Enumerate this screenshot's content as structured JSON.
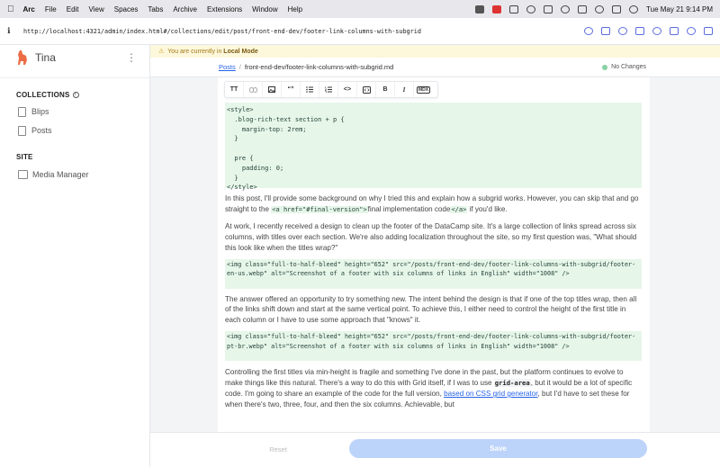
{
  "menubar": {
    "app": "Arc",
    "items": [
      "File",
      "Edit",
      "View",
      "Spaces",
      "Tabs",
      "Archive",
      "Extensions",
      "Window",
      "Help"
    ],
    "datetime": "Tue May 21  9:14 PM"
  },
  "browser": {
    "url": "http://localhost:4321/admin/index.html#/collections/edit/post/front-end-dev/footer-link-columns-with-subgrid"
  },
  "sidebar": {
    "brand": "Tina",
    "collections_title": "COLLECTIONS",
    "collections": [
      "Blips",
      "Posts"
    ],
    "site_title": "SITE",
    "site_items": [
      "Media Manager"
    ]
  },
  "banner": {
    "prefix": "You are currently in",
    "mode": "Local Mode"
  },
  "breadcrumb": {
    "collection": "Posts",
    "separator": "/",
    "file": "front-end-dev/footer-link-columns-with-subgrid.md",
    "status": "No Changes"
  },
  "toolbar": {
    "heading": "TT",
    "quote": "“”",
    "code": "<>",
    "bold": "B",
    "italic": "I",
    "mdx": "MDX"
  },
  "content": {
    "code_style": "<style>\n  .blog-rich-text section + p {\n    margin-top: 2rem;\n  }\n\n  pre {\n    padding: 0;\n  }\n</style>",
    "p1_a": "In this post, I'll provide some background on why I tried this and explain how a subgrid works. However, you can skip that and go straight to the ",
    "p1_code1": "<a href=\"#final-version\">",
    "p1_b": "final implementation code",
    "p1_code2": "</a>",
    "p1_c": " if you'd like.",
    "p2": "At work, I recently received a design to clean up the footer of the DataCamp site. It's a large collection of links spread across six columns, with titles over each section. We're also adding localization throughout the site, so my first question was, \"What should this look like when the titles wrap?\"",
    "img1": "<img class=\"full-to-half-bleed\" height=\"652\" src=\"/posts/front-end-dev/footer-link-columns-with-subgrid/footer-en-us.webp\" alt=\"Screenshot of a footer with six columns of links in English\" width=\"1008\" />",
    "p3": "The answer offered an opportunity to try something new. The intent behind the design is that if one of the top titles wrap, then all of the links shift down and start at the same vertical point. To achieve this, I either need to control the height of the first title in each column or I have to use some approach that \"knows\" it.",
    "img2": "<img class=\"full-to-half-bleed\" height=\"652\" src=\"/posts/front-end-dev/footer-link-columns-with-subgrid/footer-pt-br.webp\" alt=\"Screenshot of a footer with six columns of links in English\" width=\"1008\" />",
    "p4_a": "Controlling the first titles via min-height is fragile and something I've done in the past, but the platform continues to evolve to make things like this natural. There's a way to do this with Grid itself, if I was to use ",
    "p4_code": "grid-area",
    "p4_b": ", but it would be a lot of specific code. I'm going to share an example of the code for the full version, ",
    "p4_link": "based on CSS grid generator",
    "p4_c": ", but I'd have to set these for when there's two, three, four, and then the six columns. Achievable, but"
  },
  "footer": {
    "reset": "Reset",
    "save": "Save"
  },
  "colors": {
    "accent": "#2563eb",
    "code_bg": "#e6f6e9",
    "banner_bg": "#fdf7dc",
    "save_bg": "#bcd3fa",
    "status_dot": "#86d2a4"
  }
}
